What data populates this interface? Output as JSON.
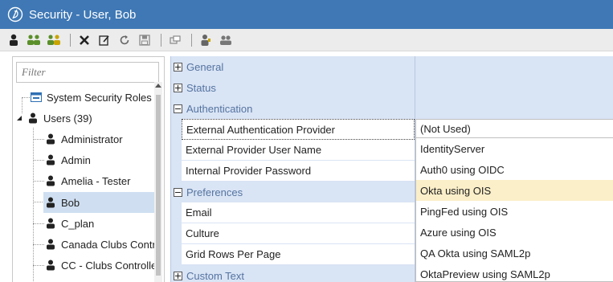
{
  "window": {
    "title": "Security - User, Bob",
    "accent_color": "#3f78b5"
  },
  "toolbar": {
    "buttons": [
      {
        "icon": "user-icon"
      },
      {
        "icon": "group-icon"
      },
      {
        "icon": "add-group-icon"
      },
      {
        "icon": "delete-icon"
      },
      {
        "icon": "edit-icon"
      },
      {
        "icon": "refresh-icon"
      },
      {
        "icon": "save-icon"
      },
      {
        "icon": "window-icon"
      },
      {
        "icon": "user-security-icon"
      },
      {
        "icon": "users-icon"
      }
    ]
  },
  "tree": {
    "filter_placeholder": "Filter",
    "system_roles_label": "System Security Roles",
    "users_label": "Users (39)",
    "users": [
      "Administrator",
      "Admin",
      "Amelia - Tester",
      "Bob",
      "C_plan",
      "Canada Clubs Contrc",
      "CC - Clubs Controller"
    ],
    "selected_user": "Bob"
  },
  "properties": {
    "categories": {
      "general": "General",
      "status": "Status",
      "authentication": "Authentication",
      "preferences": "Preferences",
      "custom_text": "Custom Text"
    },
    "authentication_rows": [
      "External Authentication Provider",
      "External Provider User Name",
      "Internal Provider Password"
    ],
    "preference_rows": [
      "Email",
      "Culture",
      "Grid Rows Per Page"
    ],
    "current_value": "(Not Used)",
    "dropdown_options": [
      "IdentityServer",
      "Auth0 using OIDC",
      "Okta using OIS",
      "PingFed using OIS",
      "Azure using OIS",
      "QA Okta using SAML2p",
      "OktaPreview using SAML2p"
    ],
    "hovered_option": "Okta using OIS"
  }
}
